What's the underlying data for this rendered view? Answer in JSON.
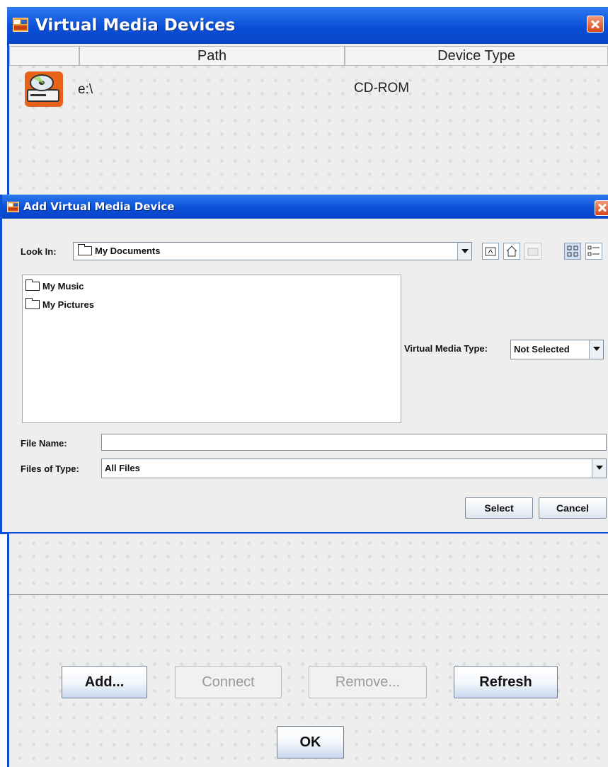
{
  "main_window": {
    "title": "Virtual Media Devices",
    "table": {
      "columns": [
        "",
        "Path",
        "Device Type"
      ],
      "rows": [
        {
          "icon": "cd-rom-drive-icon",
          "path": "e:\\",
          "device_type": "CD-ROM"
        }
      ]
    },
    "buttons": {
      "add": "Add...",
      "connect": "Connect",
      "remove": "Remove...",
      "refresh": "Refresh",
      "ok": "OK"
    }
  },
  "add_dialog": {
    "title": "Add Virtual Media Device",
    "look_in_label": "Look In:",
    "look_in_value": "My Documents",
    "toolbar_icons": [
      "up-one-level-icon",
      "home-icon",
      "new-folder-icon",
      "list-view-icon",
      "details-view-icon"
    ],
    "files": [
      "My Music",
      "My Pictures"
    ],
    "virtual_media_type_label": "Virtual Media Type:",
    "virtual_media_type_value": "Not Selected",
    "file_name_label": "File Name:",
    "file_name_value": "",
    "files_of_type_label": "Files of Type:",
    "files_of_type_value": "All Files",
    "select_button": "Select",
    "cancel_button": "Cancel"
  },
  "colors": {
    "titlebar": "#0a4fd8",
    "background": "#eeeeee",
    "close_button": "#d9441c"
  }
}
